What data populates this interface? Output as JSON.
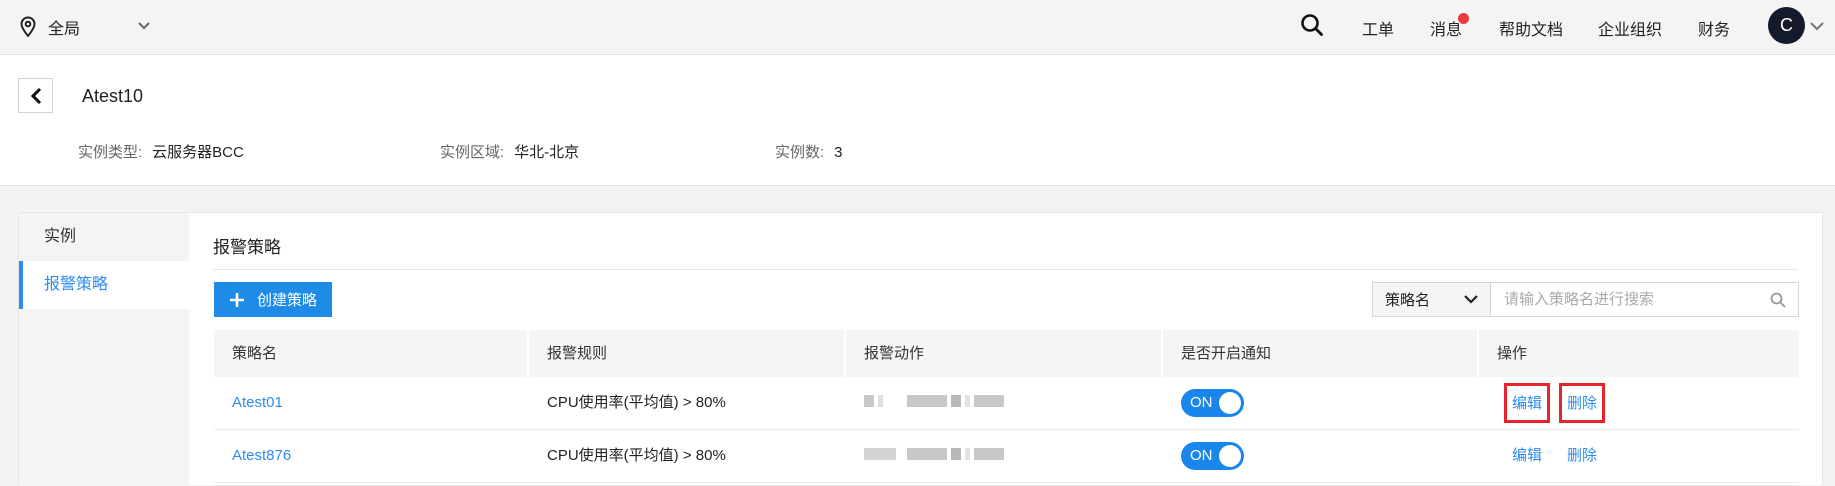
{
  "topbar": {
    "region": "全局",
    "nav": [
      "工单",
      "消息",
      "帮助文档",
      "企业组织",
      "财务"
    ],
    "avatar_letter": "C"
  },
  "header": {
    "title": "Atest10",
    "meta": [
      {
        "key": "实例类型:",
        "value": "云服务器BCC"
      },
      {
        "key": "实例区域:",
        "value": "华北-北京"
      },
      {
        "key": "实例数:",
        "value": "3"
      }
    ]
  },
  "sidebar": {
    "items": [
      {
        "label": "实例",
        "active": false
      },
      {
        "label": "报警策略",
        "active": true
      }
    ]
  },
  "panel": {
    "title": "报警策略",
    "create_label": "创建策略",
    "search": {
      "select_value": "策略名",
      "placeholder": "请输入策略名进行搜索"
    }
  },
  "table": {
    "columns": [
      "策略名",
      "报警规则",
      "报警动作",
      "是否开启通知",
      "操作"
    ],
    "rows": [
      {
        "name": "Atest01",
        "rule": "CPU使用率(平均值) > 80%",
        "notify": "ON",
        "edit": "编辑",
        "delete": "删除"
      },
      {
        "name": "Atest876",
        "rule": "CPU使用率(平均值) > 80%",
        "notify": "ON",
        "edit": "编辑",
        "delete": "删除"
      }
    ]
  },
  "colors": {
    "accent": "#2d8cf0",
    "button": "#1e8ce6",
    "toggle": "#1a86ec",
    "highlight": "#e5242b",
    "badge": "#ea3a3a"
  }
}
